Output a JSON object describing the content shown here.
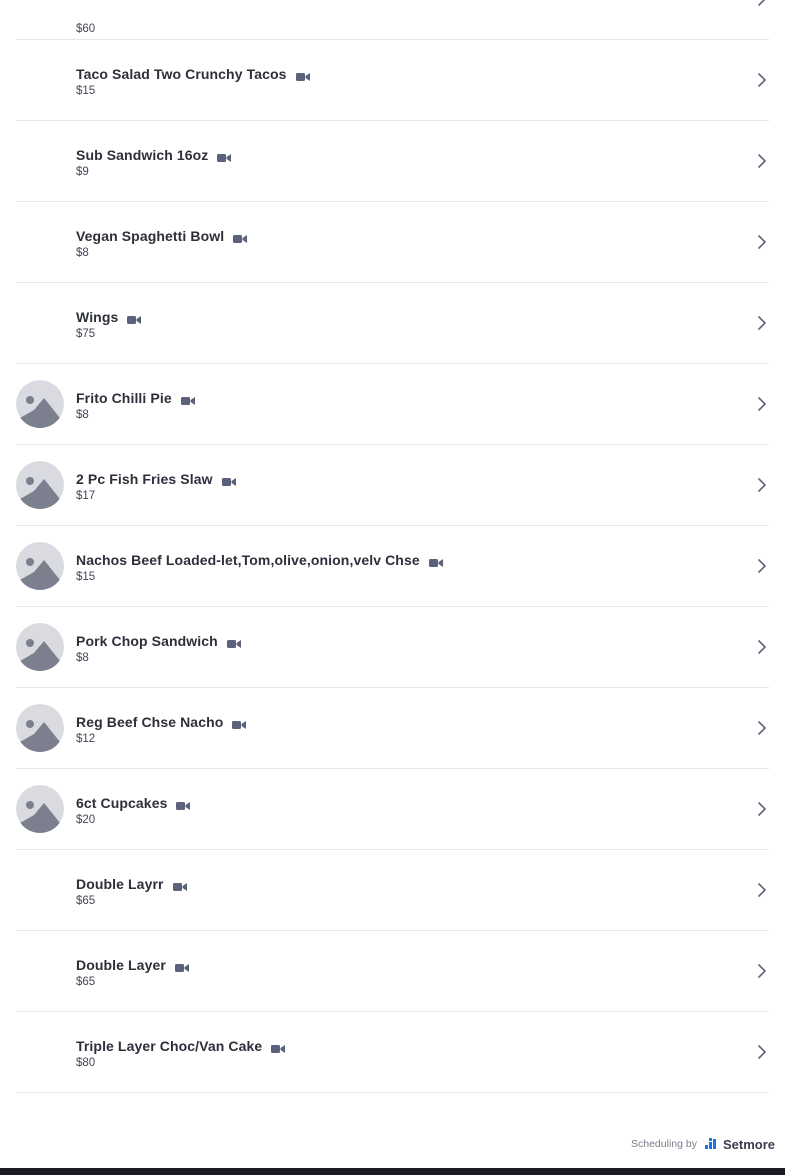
{
  "services": [
    {
      "name": "",
      "price": "$60",
      "has_image": false
    },
    {
      "name": "Taco Salad Two Crunchy Tacos",
      "price": "$15",
      "has_image": false
    },
    {
      "name": "Sub Sandwich 16oz",
      "price": "$9",
      "has_image": false
    },
    {
      "name": "Vegan Spaghetti Bowl",
      "price": "$8",
      "has_image": false
    },
    {
      "name": "Wings",
      "price": "$75",
      "has_image": false
    },
    {
      "name": "Frito Chilli Pie",
      "price": "$8",
      "has_image": true
    },
    {
      "name": "2 Pc Fish Fries Slaw",
      "price": "$17",
      "has_image": true
    },
    {
      "name": "Nachos Beef Loaded-let,Tom,olive,onion,velv Chse",
      "price": "$15",
      "has_image": true
    },
    {
      "name": "Pork Chop Sandwich",
      "price": "$8",
      "has_image": true
    },
    {
      "name": "Reg Beef Chse Nacho",
      "price": "$12",
      "has_image": true
    },
    {
      "name": "6ct Cupcakes",
      "price": "$20",
      "has_image": true
    },
    {
      "name": "Double Layrr",
      "price": "$65",
      "has_image": false
    },
    {
      "name": "Double Layer",
      "price": "$65",
      "has_image": false
    },
    {
      "name": "Triple Layer Choc/Van Cake",
      "price": "$80",
      "has_image": false
    }
  ],
  "icons": {
    "video": "video-camera-icon",
    "chevron": "chevron-right-icon",
    "placeholder": "image-placeholder-icon",
    "brand": "setmore-logo-icon"
  },
  "colors": {
    "icon": "#5b6279",
    "divider": "#e4e6eb",
    "placeholder_bg": "#d9dbe1",
    "placeholder_fg": "#7b7f8e",
    "brand_blue": "#1a73e8"
  },
  "footer": {
    "label": "Scheduling by",
    "brand": "Setmore"
  }
}
